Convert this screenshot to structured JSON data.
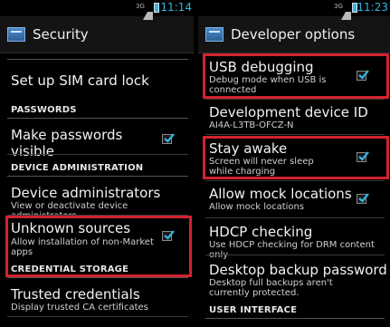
{
  "left": {
    "status": {
      "signal": "3G",
      "time": "11:14"
    },
    "title": "Security",
    "items": {
      "sim_lock": "Set up SIM card lock",
      "passwords_header": "PASSWORDS",
      "make_visible": "Make passwords visible",
      "device_admin_header": "DEVICE ADMINISTRATION",
      "device_admins_title": "Device administrators",
      "device_admins_summary": "View or deactivate device administrators",
      "unknown_title": "Unknown sources",
      "unknown_summary": "Allow installation of non-Market apps",
      "credential_header": "CREDENTIAL STORAGE",
      "trusted_title": "Trusted credentials",
      "trusted_summary": "Display trusted CA certificates"
    }
  },
  "right": {
    "status": {
      "signal": "3G",
      "time": "11:23"
    },
    "title": "Developer options",
    "items": {
      "usb_title": "USB debugging",
      "usb_summary": "Debug mode when USB is connected",
      "devid_title": "Development device ID",
      "devid_value": "AI4A-L3TB-OFCZ-N",
      "stay_title": "Stay awake",
      "stay_summary": "Screen will never sleep while charging",
      "mock_title": "Allow mock locations",
      "mock_summary": "Allow mock locations",
      "hdcp_title": "HDCP checking",
      "hdcp_summary": "Use HDCP checking for DRM content only",
      "backup_title": "Desktop backup password",
      "backup_summary": "Desktop full backups aren't currently protected.",
      "ui_header": "USER INTERFACE"
    }
  },
  "colors": {
    "accent": "#33b5e5",
    "highlight": "#d3222e",
    "background": "#000000"
  }
}
